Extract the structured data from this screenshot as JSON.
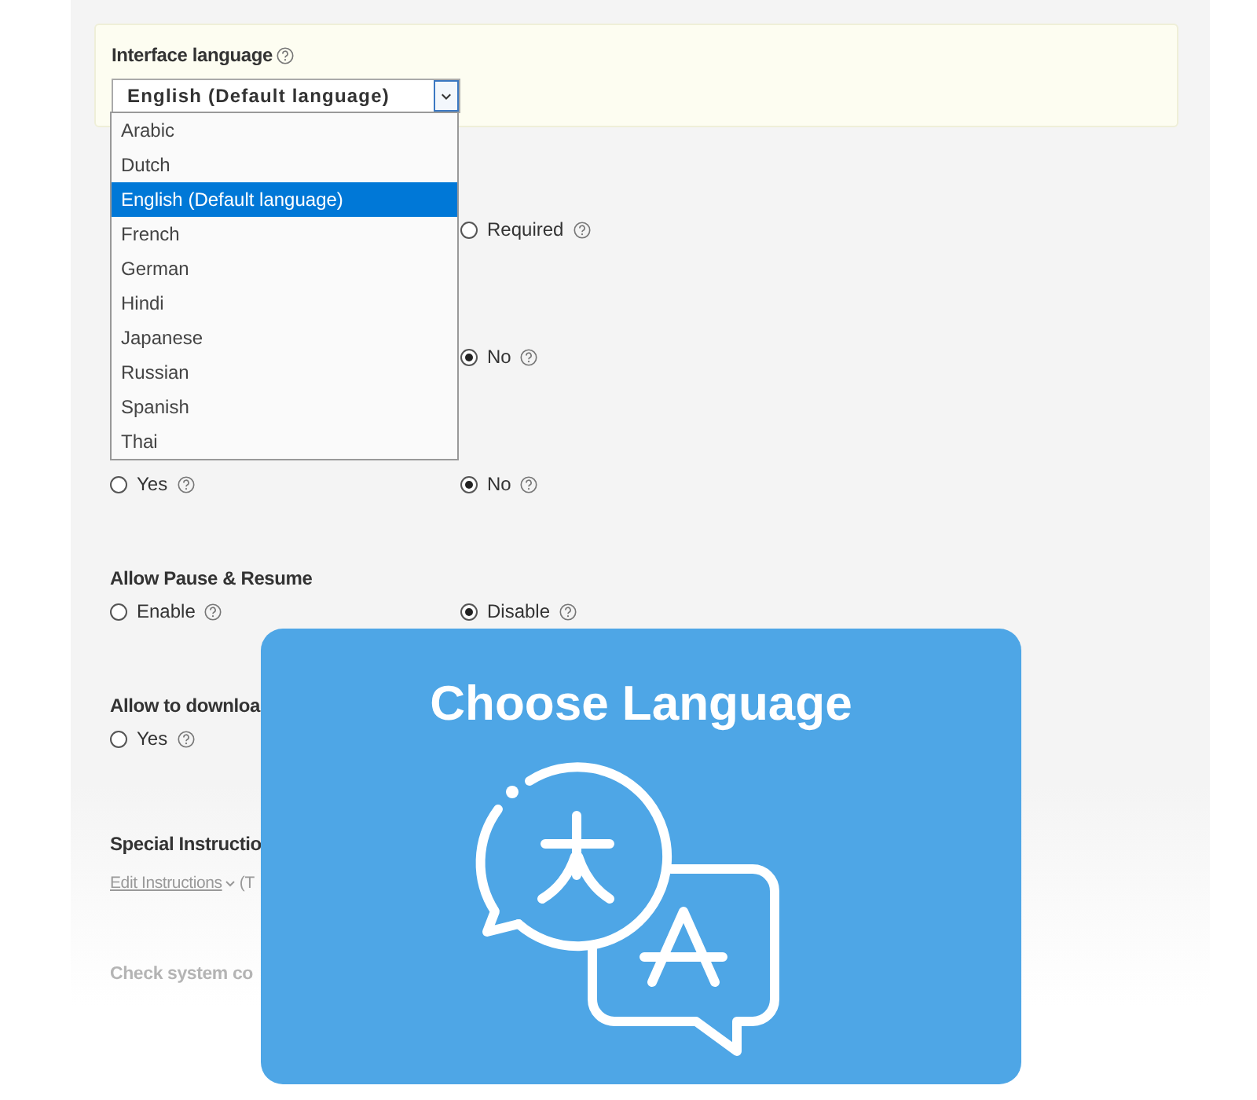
{
  "language_setting": {
    "label": "Interface language",
    "select_value": "English (Default language)",
    "options": [
      {
        "label": "Arabic",
        "selected": false
      },
      {
        "label": "Dutch",
        "selected": false
      },
      {
        "label": "English (Default language)",
        "selected": true
      },
      {
        "label": "French",
        "selected": false
      },
      {
        "label": "German",
        "selected": false
      },
      {
        "label": "Hindi",
        "selected": false
      },
      {
        "label": "Japanese",
        "selected": false
      },
      {
        "label": "Russian",
        "selected": false
      },
      {
        "label": "Spanish",
        "selected": false
      },
      {
        "label": "Thai",
        "selected": false
      }
    ]
  },
  "settings": [
    {
      "right": {
        "label": "Required",
        "selected": false
      }
    },
    {
      "right": {
        "label": "No",
        "selected": true
      }
    },
    {
      "left": {
        "label": "Yes",
        "selected": false
      },
      "right": {
        "label": "No",
        "selected": true
      }
    },
    {
      "heading": "Allow Pause & Resume",
      "left": {
        "label": "Enable",
        "selected": false
      },
      "right": {
        "label": "Disable",
        "selected": true
      }
    },
    {
      "heading": "Allow to downloa",
      "left": {
        "label": "Yes",
        "selected": false
      }
    }
  ],
  "special_instructions": {
    "heading": "Special Instructio",
    "link": "Edit Instructions",
    "note": "(T"
  },
  "check_system": "Check system co",
  "overlay": {
    "title": "Choose Language"
  }
}
